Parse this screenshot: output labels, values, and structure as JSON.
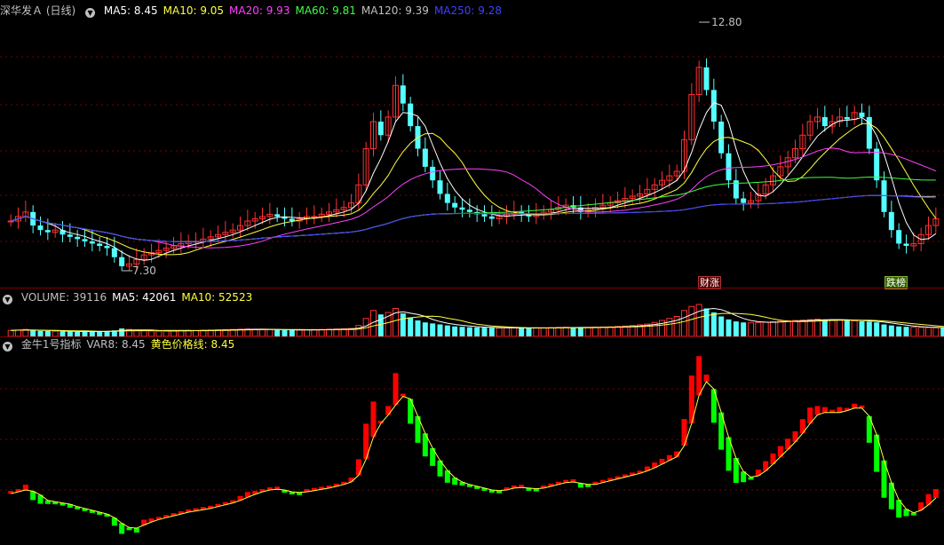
{
  "main_header": {
    "title": "深华发Ａ (日线)",
    "items": [
      {
        "label": "MA5: 8.45",
        "color": "#ffffff"
      },
      {
        "label": "MA10: 9.05",
        "color": "#ffff40"
      },
      {
        "label": "MA20: 9.93",
        "color": "#ff40ff"
      },
      {
        "label": "MA60: 9.81",
        "color": "#40ff40"
      },
      {
        "label": "MA120: 9.39",
        "color": "#c0c0c0"
      },
      {
        "label": "MA250: 9.28",
        "color": "#4040ff"
      }
    ]
  },
  "volume_header": {
    "items": [
      {
        "label": "VOLUME: 39116",
        "color": "#c0c0c0"
      },
      {
        "label": "MA5: 42061",
        "color": "#ffffff"
      },
      {
        "label": "MA10: 52523",
        "color": "#ffff40"
      }
    ]
  },
  "indicator_header": {
    "items": [
      {
        "label": "金牛1号指标",
        "color": "#c0c0c0"
      },
      {
        "label": "VAR8: 8.45",
        "color": "#c0c0c0"
      },
      {
        "label": "黄色价格线: 8.45",
        "color": "#ffff40"
      }
    ]
  },
  "annotations": {
    "high_label": "12.80",
    "low_label": "7.30",
    "tag1": "财涨",
    "tag2": "跌榜"
  },
  "colors": {
    "up": "#ff3030",
    "down": "#54ffff",
    "grid": "#7a0000",
    "osc_up": "#ff0000",
    "osc_down": "#00ff00"
  },
  "chart_data": {
    "type": "candlestick",
    "price_range": [
      7.3,
      12.8
    ],
    "closes": [
      8.4,
      8.5,
      8.6,
      8.3,
      8.2,
      8.15,
      8.2,
      8.1,
      8.05,
      8.0,
      7.95,
      7.9,
      7.85,
      7.8,
      7.6,
      7.4,
      7.45,
      7.55,
      7.65,
      7.7,
      7.75,
      7.8,
      7.85,
      7.9,
      7.95,
      7.95,
      8.0,
      8.05,
      8.1,
      8.15,
      8.2,
      8.3,
      8.4,
      8.45,
      8.5,
      8.55,
      8.5,
      8.45,
      8.4,
      8.45,
      8.5,
      8.5,
      8.55,
      8.6,
      8.65,
      8.7,
      8.8,
      9.2,
      10.0,
      10.6,
      10.3,
      10.7,
      11.4,
      11.0,
      10.5,
      10.0,
      9.6,
      9.3,
      9.0,
      8.8,
      8.7,
      8.65,
      8.6,
      8.55,
      8.5,
      8.45,
      8.5,
      8.55,
      8.6,
      8.55,
      8.5,
      8.55,
      8.6,
      8.65,
      8.7,
      8.75,
      8.7,
      8.6,
      8.65,
      8.7,
      8.75,
      8.8,
      8.85,
      8.9,
      8.95,
      9.0,
      9.1,
      9.2,
      9.3,
      9.4,
      9.5,
      10.2,
      11.2,
      11.8,
      11.3,
      10.6,
      9.9,
      9.3,
      8.9,
      8.8,
      8.85,
      9.0,
      9.2,
      9.4,
      9.6,
      9.8,
      10.0,
      10.3,
      10.6,
      10.7,
      10.5,
      10.6,
      10.7,
      10.65,
      10.8,
      10.7,
      10.0,
      9.3,
      8.6,
      8.2,
      7.9,
      7.85,
      7.9,
      8.1,
      8.3,
      8.45
    ],
    "volumes": [
      30000,
      32000,
      35000,
      30000,
      28000,
      27000,
      26000,
      25000,
      24000,
      23000,
      24000,
      25000,
      26000,
      27000,
      30000,
      40000,
      35000,
      30000,
      28000,
      27000,
      26000,
      27000,
      28000,
      29000,
      30000,
      30000,
      31000,
      32000,
      33000,
      34000,
      35000,
      36000,
      37000,
      36000,
      35000,
      34000,
      33000,
      32000,
      31000,
      32000,
      33000,
      34000,
      35000,
      36000,
      37000,
      38000,
      40000,
      55000,
      90000,
      130000,
      110000,
      120000,
      140000,
      115000,
      95000,
      80000,
      70000,
      65000,
      60000,
      55000,
      50000,
      48000,
      46000,
      45000,
      44000,
      43000,
      42000,
      42000,
      43000,
      42000,
      41000,
      42000,
      43000,
      44000,
      45000,
      46000,
      45000,
      44000,
      45000,
      46000,
      47000,
      48000,
      50000,
      52000,
      55000,
      58000,
      62000,
      70000,
      80000,
      90000,
      100000,
      130000,
      150000,
      160000,
      140000,
      120000,
      100000,
      85000,
      75000,
      70000,
      68000,
      70000,
      72000,
      74000,
      76000,
      78000,
      80000,
      82000,
      84000,
      86000,
      84000,
      83000,
      82000,
      80000,
      78000,
      76000,
      74000,
      70000,
      60000,
      55000,
      50000,
      48000,
      46000,
      45000,
      44000,
      43000,
      42000,
      39116
    ],
    "indicator": {
      "name": "金牛1号指标",
      "var8_last": 8.45,
      "yellow_line_last": 8.45
    }
  }
}
